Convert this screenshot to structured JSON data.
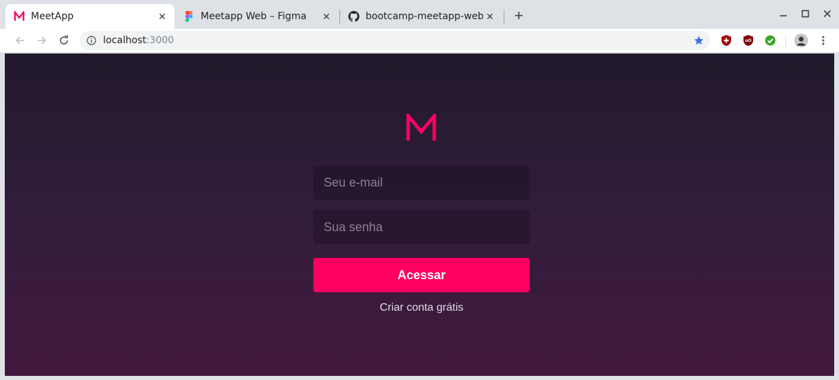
{
  "browser": {
    "tabs": [
      {
        "title": "MeetApp",
        "active": true,
        "favicon": "meetapp-logo-icon"
      },
      {
        "title": "Meetapp Web – Figma",
        "active": false,
        "favicon": "figma-icon"
      },
      {
        "title": "bootcamp-meetapp-web/",
        "active": false,
        "favicon": "github-icon"
      }
    ],
    "url_host": "localhost",
    "url_port": ":3000"
  },
  "login": {
    "email_placeholder": "Seu e-mail",
    "password_placeholder": "Sua senha",
    "submit_label": "Acessar",
    "signup_link": "Criar conta grátis"
  },
  "colors": {
    "brand": "#ff0060",
    "bg_top": "#22192b",
    "bg_bottom": "#43183f"
  }
}
